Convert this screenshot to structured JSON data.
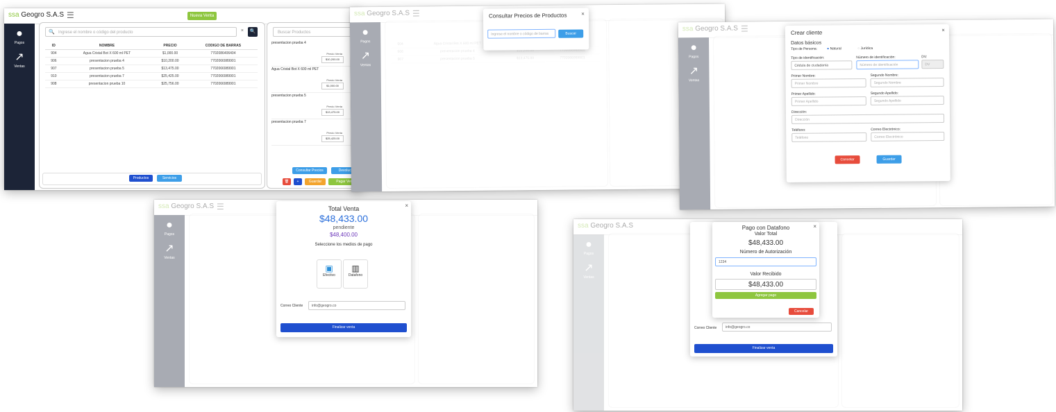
{
  "screens": {
    "pos_main": {
      "brand_prefix": "ssa",
      "brand_name": "Geogro S.A.S",
      "burger": "☰",
      "green_button": "Nueva Venta",
      "sidebar": [
        {
          "label": "Pagos",
          "icon": "user-icon"
        },
        {
          "label": "Ventas",
          "icon": "chart-icon"
        }
      ],
      "search_placeholder": "Ingrese el nombre o código del producto",
      "clear_x": "×",
      "table_headers": [
        "ID",
        "NOMBRE",
        "PRECIO",
        "CODIGO DE BARRAS"
      ],
      "table_rows": [
        [
          "904",
          "Agua Cristal Bot X 600 ml PET",
          "$1,000.00",
          "7702086406404"
        ],
        [
          "906",
          "presentacion prueba 4",
          "$10,200.00",
          "7702066989901"
        ],
        [
          "907",
          "presentacion prueba 5",
          "$13,475.00",
          "7702066989901"
        ],
        [
          "910",
          "presentacion prueba 7",
          "$25,425.00",
          "7702066989901"
        ],
        [
          "908",
          "presentacion prueba 10",
          "$25,756.00",
          "7702066989901"
        ]
      ],
      "bottom_buttons": [
        "Productos",
        "Servicios"
      ],
      "cart_search_placeholder": "Buscar Productos",
      "cart_items": [
        {
          "name": "presentacion prueba 4",
          "price_label": "Precio Venta",
          "price": "$10,200.00"
        },
        {
          "name": "Agua Cristal Bot X 600 ml PET",
          "price_label": "Precio Venta",
          "price": "$1,000.00"
        },
        {
          "name": "presentacion prueba 5",
          "price_label": "Precio Venta",
          "price": "$13,475.00"
        },
        {
          "name": "presentacion prueba 7",
          "price_label": "Precio Venta",
          "price": "$25,425.00"
        }
      ],
      "cart_buttons": [
        "Consultar Precios",
        "Devolución"
      ],
      "action_buttons": [
        "Guardar",
        "Pagar Venta"
      ]
    },
    "price_lookup": {
      "title": "Consultar Precios de Productos",
      "close": "×",
      "placeholder": "Ingrese el nombre o código de barras",
      "button": "Buscar"
    },
    "create_client": {
      "title": "Crear cliente",
      "close": "×",
      "section": "Datos básicos",
      "person_type_label": "Tipo de Persona:",
      "person_types": [
        "Natural",
        "Jurídica"
      ],
      "fields": [
        {
          "label": "Tipo de identificación:",
          "value": "Cédula de ciudadanía"
        },
        {
          "label": "Número de identificación:",
          "value": "Número de identificación"
        },
        {
          "label": "DV:",
          "value": "DV"
        },
        {
          "label": "Primer Nombre:",
          "value": "Primer Nombre"
        },
        {
          "label": "Segundo Nombre:",
          "value": "Segundo Nombre"
        },
        {
          "label": "Primer Apellido:",
          "value": "Primer Apellido"
        },
        {
          "label": "Segundo Apellido:",
          "value": "Segundo Apellido"
        },
        {
          "label": "Dirección:",
          "value": "Dirección"
        },
        {
          "label": "Teléfono:",
          "value": "Teléfono"
        },
        {
          "label": "Correo Electrónico:",
          "value": "Correo Electrónico"
        }
      ],
      "cancel": "Cancelar",
      "save": "Guardar"
    },
    "payment": {
      "total_label": "Total Venta",
      "total": "$48,433.00",
      "pending_label": "pendiente",
      "pending": "$48,400.00",
      "select_label": "Seleccione los medios de pago",
      "methods": [
        {
          "label": "Efectivo",
          "icon": "cash-icon"
        },
        {
          "label": "Datafono",
          "icon": "card-terminal-icon"
        }
      ],
      "client_email_label": "Correo Cliente",
      "client_email": "info@geogro.co",
      "finish": "Finalizar venta",
      "close": "×"
    },
    "dataphone": {
      "title": "Pago con Datafono",
      "total_label": "Valor Total",
      "total": "$48,433.00",
      "auth_label": "Número de Autorización",
      "auth_value": "1234",
      "received_label": "Valor Recibido",
      "received": "$48,433.00",
      "add_button": "Agregar pago",
      "cancel_button": "Cancelar",
      "client_email_label": "Correo Cliente",
      "client_email": "info@geogro.co",
      "finish": "Finalizar venta",
      "close": "×"
    }
  }
}
